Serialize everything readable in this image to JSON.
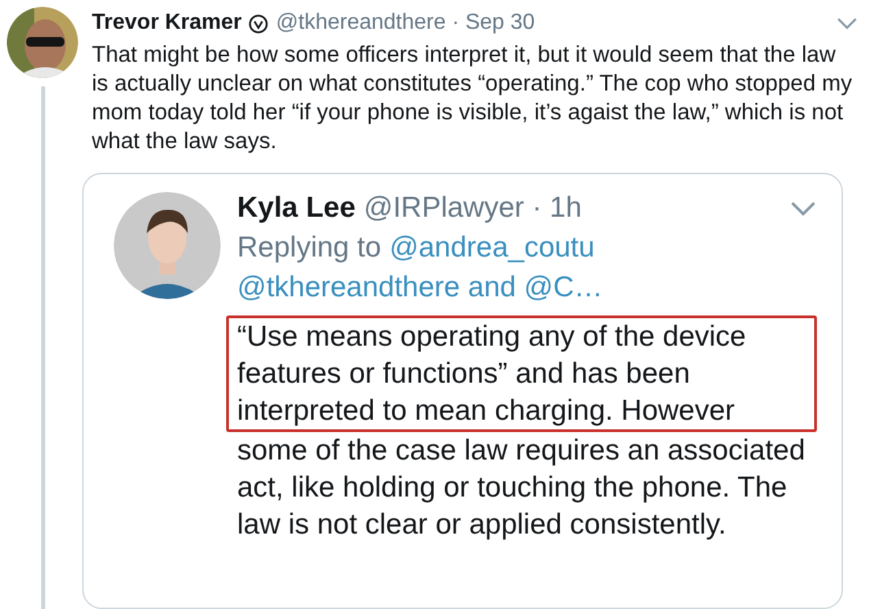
{
  "tweet": {
    "author": "Trevor Kramer",
    "verified": true,
    "meta": "@tkhereandthere · Sep 30",
    "text": "That might be how some officers interpret it, but it would seem that the law is actually unclear on what constitutes “operating.” The cop who stopped my mom today told her “if your phone is visible, it’s agaist the law,” which is not what the law says.",
    "quoted": {
      "author": "Kyla Lee",
      "meta": "@IRPlawyer · 1h",
      "replying_label": "Replying to",
      "replying_to": "@andrea_coutu",
      "replying_more": "@tkhereandthere and @C…",
      "highlighted_text": "“Use means operating any of the device features or functions” and has been interpreted to mean charging. However",
      "text": "some of the case law requires an associated act, like holding or touching the phone. The law is not clear or applied consistently."
    }
  }
}
